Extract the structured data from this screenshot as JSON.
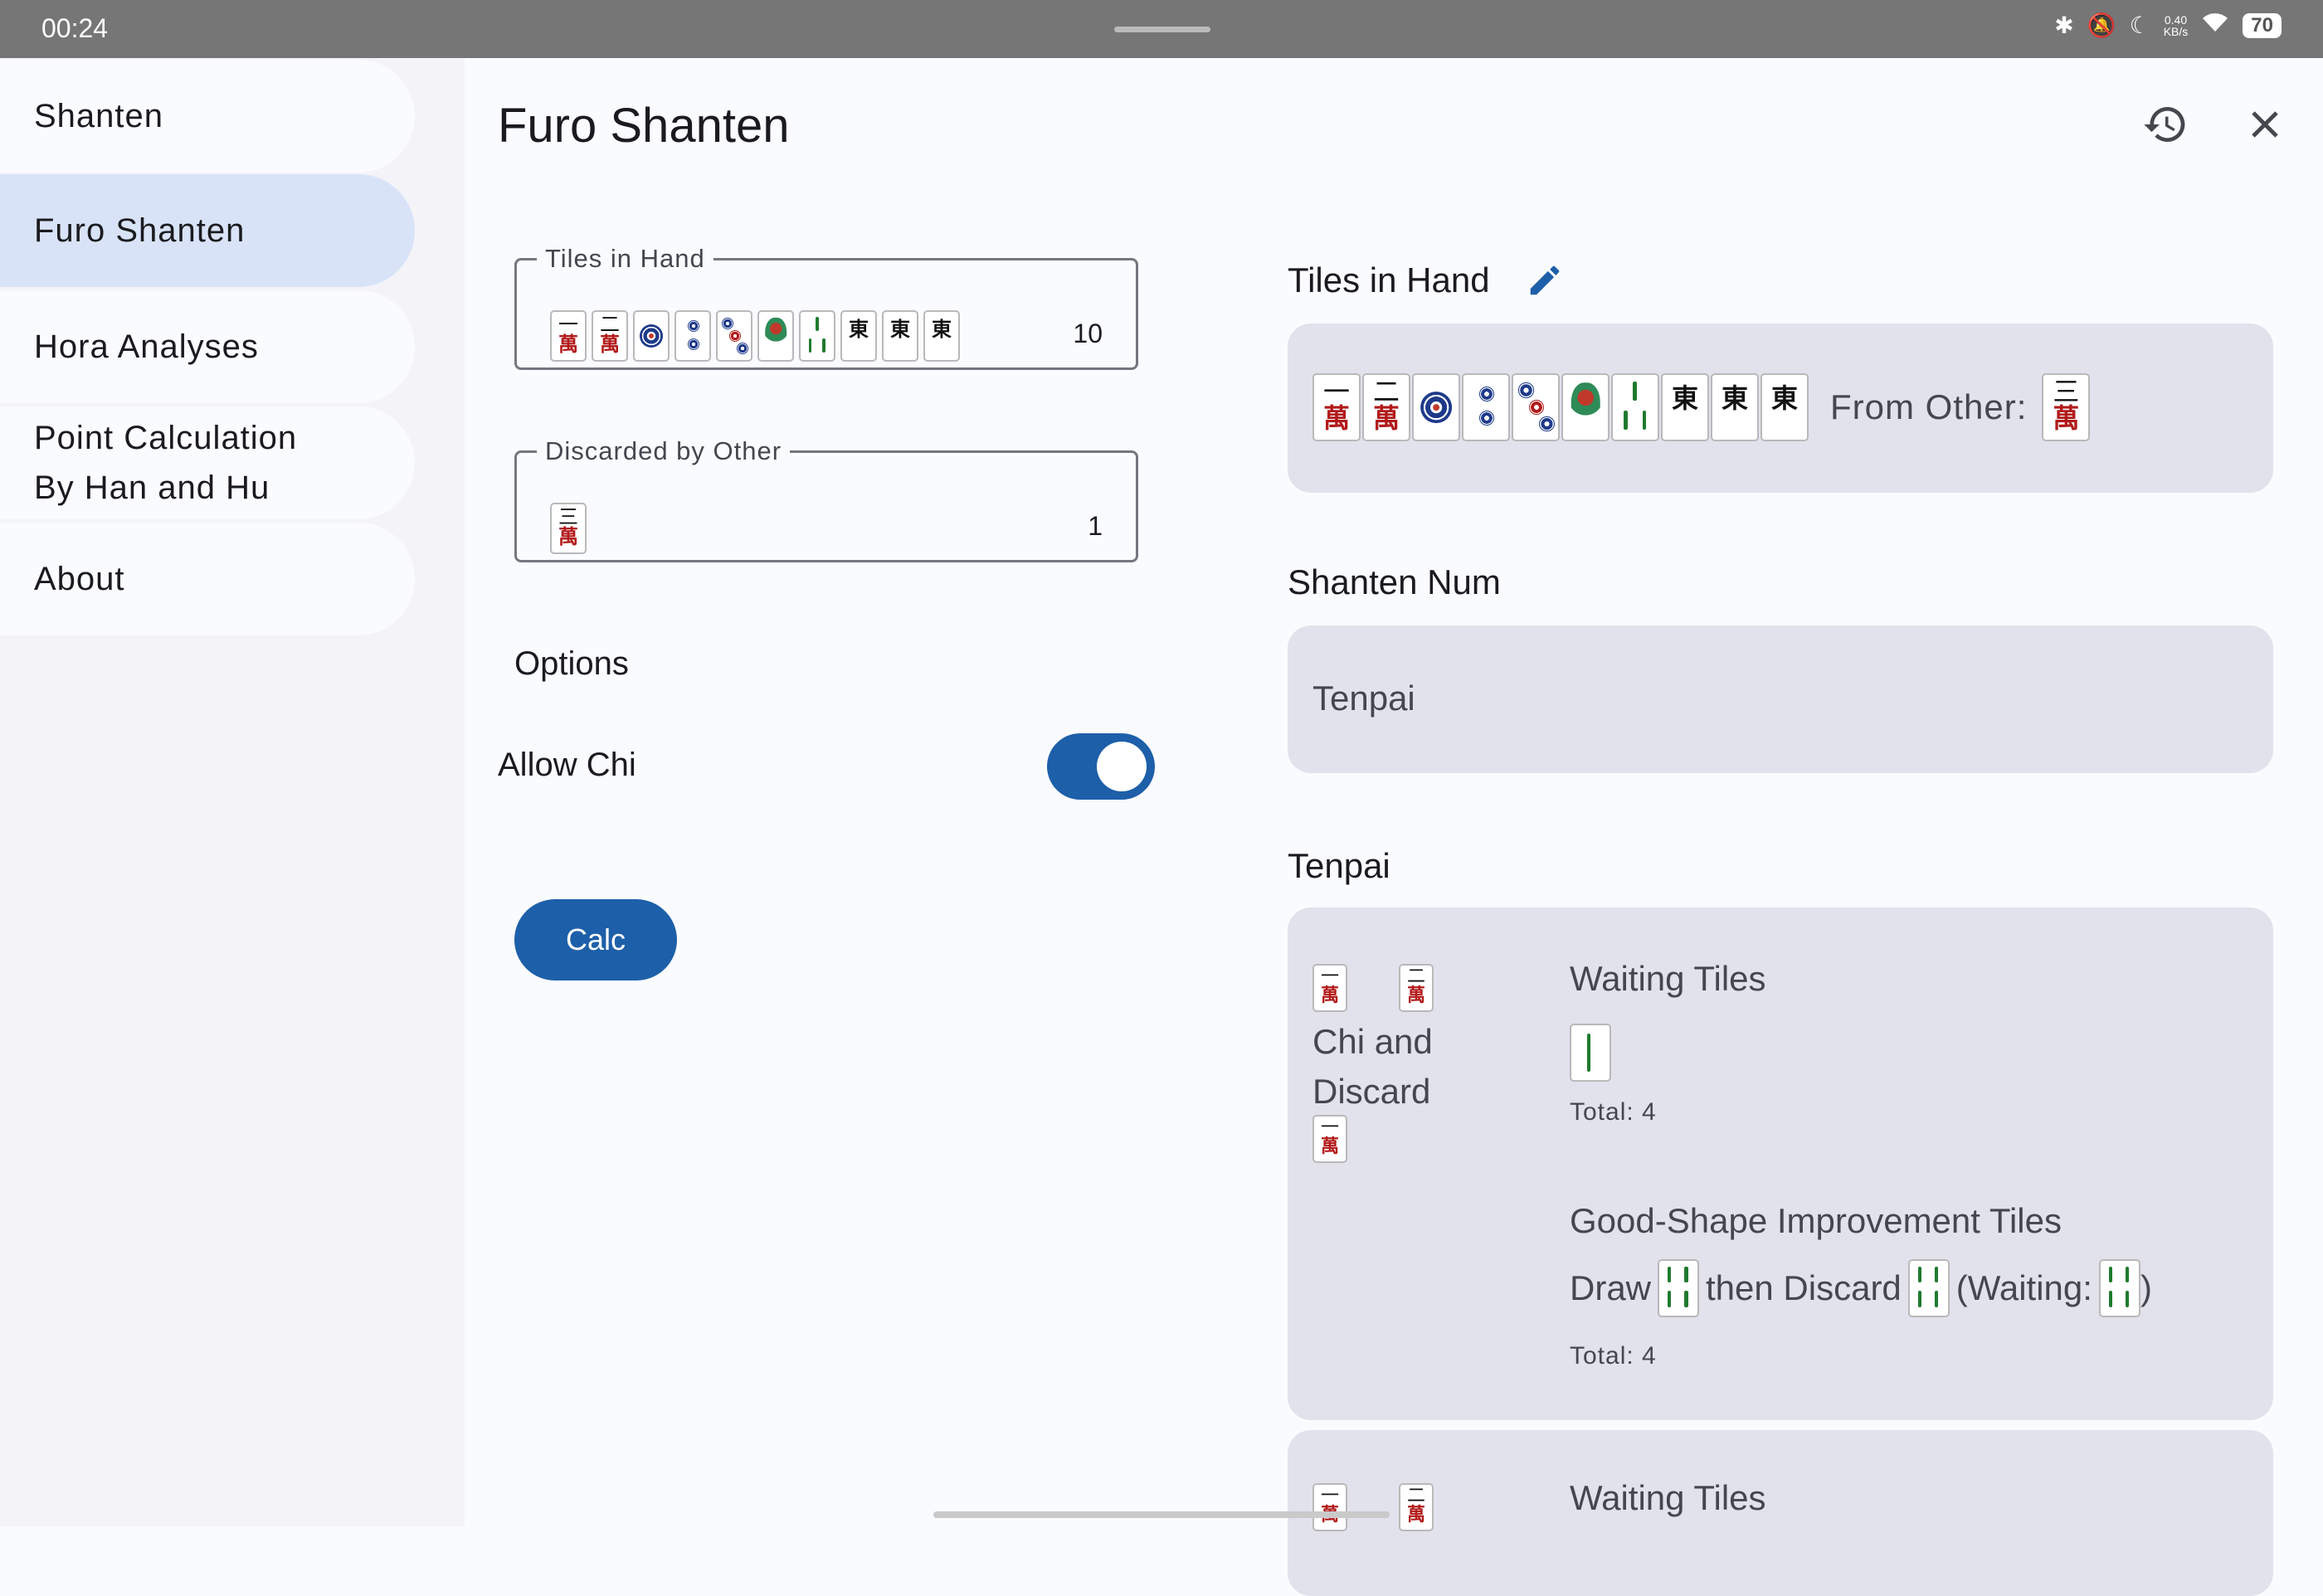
{
  "status_bar": {
    "time": "00:24",
    "battery": "70",
    "net_speed_value": "0.40",
    "net_speed_unit": "KB/s"
  },
  "sidebar": {
    "items": [
      {
        "label": "Shanten"
      },
      {
        "label": "Furo Shanten"
      },
      {
        "label": "Hora Analyses"
      },
      {
        "label": "Point Calculation\nBy Han and Hu"
      },
      {
        "label": "About"
      }
    ]
  },
  "header": {
    "title": "Furo Shanten",
    "history_icon": "history-icon",
    "close_icon": "close-icon"
  },
  "form": {
    "tiles_in_hand": {
      "label": "Tiles in Hand",
      "count": "10"
    },
    "discarded_by_other": {
      "label": "Discarded by Other",
      "count": "1"
    },
    "options_title": "Options",
    "allow_chi": {
      "label": "Allow Chi",
      "value": true
    },
    "calc_label": "Calc"
  },
  "result": {
    "tiles_in_hand_title": "Tiles in Hand",
    "edit_icon": "pencil-icon",
    "from_other_label": "From Other:",
    "shanten_num_title": "Shanten Num",
    "shanten_value": "Tenpai",
    "tenpai_title": "Tenpai",
    "entry1": {
      "action_label": "Chi and Discard",
      "waiting_title": "Waiting Tiles",
      "waiting_total": "Total: 4",
      "good_shape_title": "Good-Shape Improvement Tiles",
      "draw_label": "Draw",
      "then_discard_label": "then Discard",
      "waiting_open": "(Waiting:",
      "waiting_close": ")",
      "good_shape_total": "Total: 4"
    },
    "entry2": {
      "waiting_title": "Waiting Tiles"
    }
  },
  "colors": {
    "accent": "#1d5fa9",
    "card": "#e1e2ec",
    "nav_active": "#d9e3f8"
  }
}
